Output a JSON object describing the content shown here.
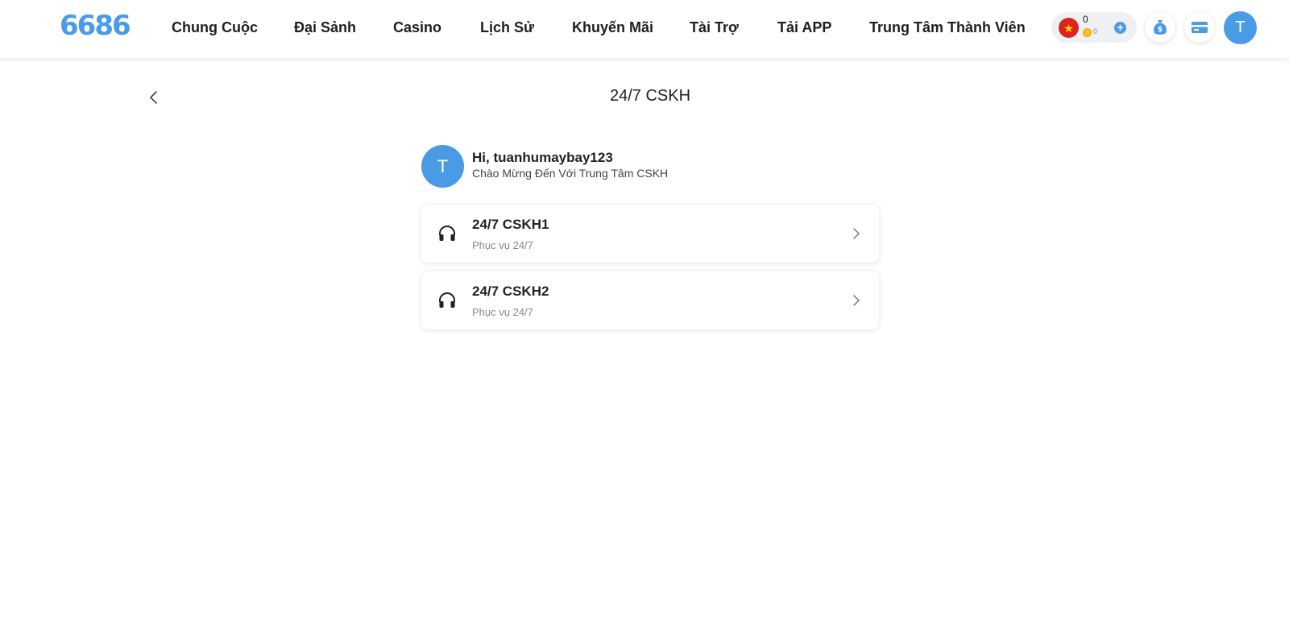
{
  "header": {
    "logo": "6686",
    "nav": [
      "Chung Cuộc",
      "Đại Sảnh",
      "Casino",
      "Lịch Sử",
      "Khuyến Mãi",
      "Tài Trợ",
      "Tải APP",
      "Trung Tâm Thành Viên"
    ],
    "balance": "0",
    "coin_balance": "0",
    "avatar_letter": "T"
  },
  "page": {
    "title": "24/7 CSKH"
  },
  "user": {
    "avatar_letter": "T",
    "greeting": "Hi, tuanhumaybay123",
    "welcome": "Chào Mừng Đến Với Trung Tâm CSKH"
  },
  "services": [
    {
      "title": "24/7 CSKH1",
      "subtitle": "Phục vụ 24/7"
    },
    {
      "title": "24/7 CSKH2",
      "subtitle": "Phục vụ 24/7"
    }
  ],
  "colors": {
    "accent": "#4a9be6",
    "flag_red": "#da251d",
    "coin": "#f7c21c"
  }
}
